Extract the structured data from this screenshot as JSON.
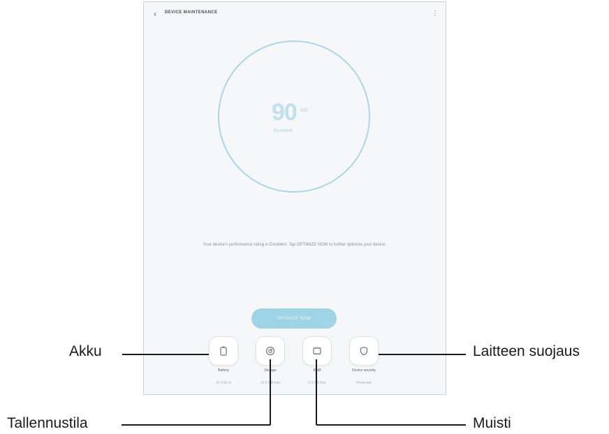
{
  "app": {
    "title": "DEVICE MAINTENANCE",
    "back_icon": "back-arrow-icon",
    "more_icon": "more-vert-icon"
  },
  "score": {
    "value": "90",
    "suffix": "/100",
    "label": "Excellent"
  },
  "description": "Your device's performance rating is Excellent. Tap OPTIMIZE NOW to further optimize your device.",
  "optimize_button": "OPTIMIZE NOW",
  "tiles": [
    {
      "name": "Battery",
      "status": "12 h 55 m",
      "icon": "battery-icon"
    },
    {
      "name": "Storage",
      "status": "12.3 GB free",
      "icon": "storage-icon"
    },
    {
      "name": "RAM",
      "status": "2.3 GB free",
      "icon": "ram-chip-icon"
    },
    {
      "name": "Device security",
      "status": "Protected",
      "icon": "shield-icon"
    }
  ],
  "callouts": {
    "battery": "Akku",
    "storage": "Tallennustila",
    "memory": "Muisti",
    "security": "Laitteen suojaus"
  },
  "colors": {
    "accent": "#9fd3e6",
    "ring": "#a9d6ea",
    "screen_bg": "#f6f7f8"
  }
}
